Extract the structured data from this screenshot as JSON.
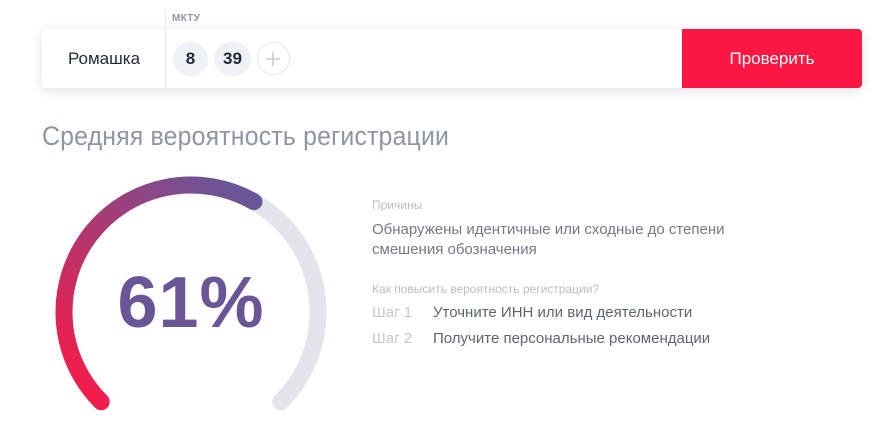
{
  "search": {
    "mktu_label": "МКТУ",
    "brand_name": "Ромашка",
    "classes": [
      "8",
      "39"
    ],
    "check_label": "Проверить"
  },
  "result": {
    "title": "Средняя вероятность регистрации",
    "probability_text": "61%",
    "probability_value": 61,
    "reasons_label": "Причины",
    "reasons_text": "Обнаружены идентичные или сходные до степени смешения обозначения",
    "improve_label": "Как повысить вероятность регистрации?",
    "steps": [
      {
        "number": "Шаг 1",
        "text": "Уточните ИНН или вид деятельности"
      },
      {
        "number": "Шаг 2",
        "text": "Получите персональные рекомендации"
      }
    ]
  },
  "colors": {
    "accent": "#ff1744",
    "gauge_start": "#ff1744",
    "gauge_end": "#6a5597",
    "gauge_track": "#e2e6ec"
  }
}
